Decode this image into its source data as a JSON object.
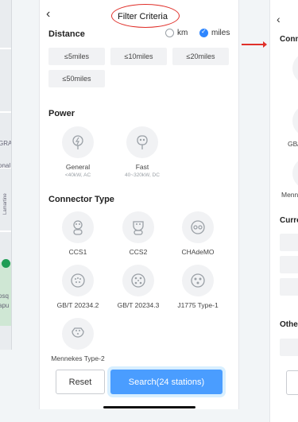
{
  "map": {
    "labels": [
      "GRA",
      "onal",
      "osq",
      "apu"
    ],
    "vertical_label": "Lamartine"
  },
  "header": {
    "back_icon": "chevron-left-icon",
    "title": "Filter Criteria"
  },
  "distance": {
    "title": "Distance",
    "units": [
      {
        "label": "km",
        "selected": false
      },
      {
        "label": "miles",
        "selected": true
      }
    ],
    "options": [
      "≤5miles",
      "≤10miles",
      "≤20miles",
      "≤50miles"
    ]
  },
  "power": {
    "title": "Power",
    "options": [
      {
        "label": "General",
        "sub": "<40kW, AC",
        "icon": "plug-general-icon"
      },
      {
        "label": "Fast",
        "sub": "40~320kW, DC",
        "icon": "plug-fast-icon"
      }
    ]
  },
  "connector": {
    "title": "Connector Type",
    "options": [
      {
        "label": "CCS1",
        "icon": "ccs1-connector-icon"
      },
      {
        "label": "CCS2",
        "icon": "ccs2-connector-icon"
      },
      {
        "label": "CHAdeMO",
        "icon": "chademo-connector-icon"
      },
      {
        "label": "GB/T 20234.2",
        "icon": "gbt-ac-connector-icon"
      },
      {
        "label": "GB/T 20234.3",
        "icon": "gbt-dc-connector-icon"
      },
      {
        "label": "J1775 Type-1",
        "icon": "j1772-connector-icon"
      },
      {
        "label": "Mennekes Type-2",
        "icon": "mennekes-connector-icon"
      }
    ]
  },
  "footer": {
    "reset_label": "Reset",
    "search_label": "Search(24 stations)"
  },
  "right_panel": {
    "sections": [
      "Conn",
      "Curre",
      "Othe"
    ],
    "labels": [
      "GB/",
      "Menne"
    ]
  },
  "colors": {
    "accent": "#2e86ff",
    "search_button": "#4a9dff",
    "annotation": "#e0302a"
  }
}
